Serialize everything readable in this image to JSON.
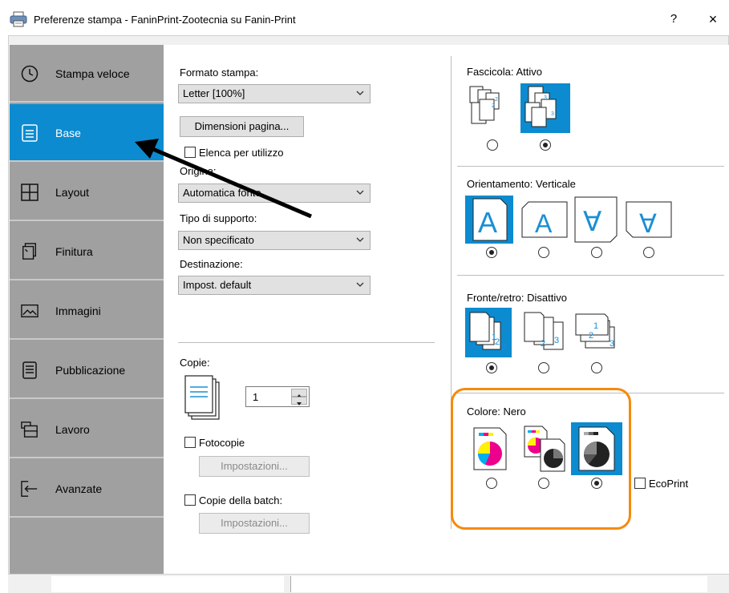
{
  "window": {
    "title": "Preferenze stampa - FaninPrint-Zootecnia su Fanin-Print",
    "help_label": "?",
    "close_label": "×"
  },
  "sidebar": {
    "items": [
      {
        "label": "Stampa veloce",
        "icon": "clock-icon"
      },
      {
        "label": "Base",
        "icon": "document-icon",
        "active": true
      },
      {
        "label": "Layout",
        "icon": "layout-grid-icon"
      },
      {
        "label": "Finitura",
        "icon": "staple-document-icon"
      },
      {
        "label": "Immagini",
        "icon": "image-icon"
      },
      {
        "label": "Pubblicazione",
        "icon": "publication-icon"
      },
      {
        "label": "Lavoro",
        "icon": "job-stack-icon"
      },
      {
        "label": "Avanzate",
        "icon": "advanced-arrow-icon"
      }
    ]
  },
  "base": {
    "formato_label": "Formato stampa:",
    "formato_value": "Letter  [100%]",
    "dimensioni_button": "Dimensioni pagina...",
    "elenca_label": "Elenca per utilizzo",
    "origine_label": "Origine:",
    "origine_value": "Automatica fonte",
    "tipo_label": "Tipo di supporto:",
    "tipo_value": "Non specificato",
    "destinazione_label": "Destinazione:",
    "destinazione_value": "Impost. default",
    "copie_label": "Copie:",
    "copie_value": "1",
    "fotocopie_label": "Fotocopie",
    "impostazioni_1": "Impostazioni...",
    "batch_label": "Copie della batch:",
    "impostazioni_2": "Impostazioni..."
  },
  "right": {
    "fascicola_label": "Fascicola:",
    "fascicola_value": "Attivo",
    "fascicola_selected": 1,
    "orientamento_label": "Orientamento:",
    "orientamento_value": "Verticale",
    "orientamento_selected": 0,
    "orient_glyphs": [
      "A",
      "A",
      "∀",
      "∀"
    ],
    "fronte_label": "Fronte/retro:",
    "fronte_value": "Disattivo",
    "fronte_selected": 0,
    "colore_label": "Colore:",
    "colore_value": "Nero",
    "colore_selected": 2,
    "ecoprint_label": "EcoPrint"
  },
  "colors": {
    "accent": "#0c8bd0",
    "highlight": "#f58a0d",
    "sidebar": "#a0a0a0"
  }
}
